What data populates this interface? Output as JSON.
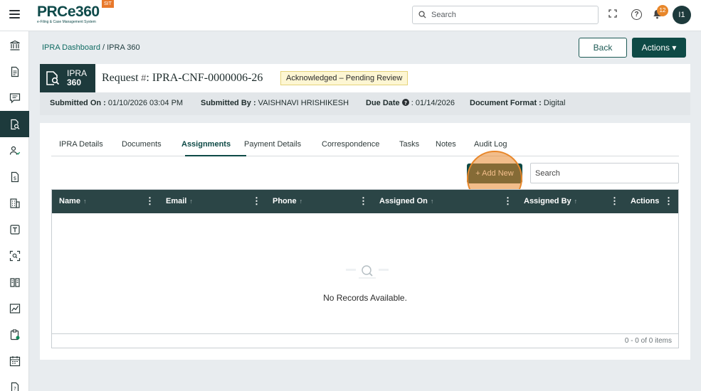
{
  "header": {
    "logo_text": "PRCe360",
    "logo_subtitle": "e-Filing & Case Management System",
    "env_badge": "SIT",
    "search_placeholder": "Search",
    "notification_count": "12",
    "avatar_initials": "I1",
    "icons": [
      "menu-icon",
      "expand-icon",
      "help-icon",
      "bell-icon"
    ]
  },
  "sidebar": {
    "items": [
      {
        "icon": "institution-icon",
        "active": false
      },
      {
        "icon": "document-icon",
        "active": false
      },
      {
        "icon": "chat-icon",
        "active": false
      },
      {
        "icon": "document-search-icon",
        "active": true
      },
      {
        "icon": "users-icon",
        "active": false
      },
      {
        "icon": "dollar-document-icon",
        "active": false
      },
      {
        "icon": "building-icon",
        "active": false
      },
      {
        "icon": "template-icon",
        "active": false
      },
      {
        "icon": "scan-icon",
        "active": false
      },
      {
        "icon": "book-icon",
        "active": false
      },
      {
        "icon": "chart-icon",
        "active": false
      },
      {
        "icon": "clipboard-icon",
        "active": false
      },
      {
        "icon": "calendar-icon",
        "active": false
      },
      {
        "icon": "help-document-icon",
        "active": false
      }
    ]
  },
  "breadcrumb": {
    "parent": "IPRA Dashboard",
    "separator": " / ",
    "current": "IPRA 360"
  },
  "page_actions": {
    "back_label": "Back",
    "actions_label": "Actions ▾"
  },
  "request": {
    "tag_line1": "IPRA",
    "tag_line2": "360",
    "title_prefix": "Request",
    "title_hash": " #",
    "title_id": ": IPRA-CNF-0000006-26",
    "status": "Acknowledged – Pending Review",
    "meta": {
      "submitted_on_label": "Submitted On :",
      "submitted_on_value": " 01/10/2026 03:04 PM",
      "submitted_by_label": "Submitted By :",
      "submitted_by_value": " VAISHNAVI HRISHIKESH",
      "due_date_label": "Due Date",
      "due_date_value": " : 01/14/2026",
      "doc_format_label": "Document Format :",
      "doc_format_value": " Digital"
    }
  },
  "tabs": [
    {
      "label": "IPRA Details",
      "active": false
    },
    {
      "label": "Documents",
      "active": false
    },
    {
      "label": "Assignments",
      "active": true
    },
    {
      "label": "Payment Details",
      "active": false
    },
    {
      "label": "Correspondence",
      "active": false
    },
    {
      "label": "Tasks",
      "active": false
    },
    {
      "label": "Notes",
      "active": false
    },
    {
      "label": "Audit Log",
      "active": false
    }
  ],
  "grid": {
    "add_new_label": "+ Add New",
    "search_placeholder": "Search",
    "columns": [
      "Name",
      "Email",
      "Phone",
      "Assigned On",
      "Assigned By",
      "Actions"
    ],
    "sort_glyph": "↑",
    "empty_message": "No Records Available.",
    "pager_text": "0 - 0 of 0 items"
  },
  "colors": {
    "brand_dark": "#1d3a3c",
    "brand_teal": "#0e4a46",
    "highlight": "#e8872a",
    "status_bg": "#fdf6d3"
  }
}
